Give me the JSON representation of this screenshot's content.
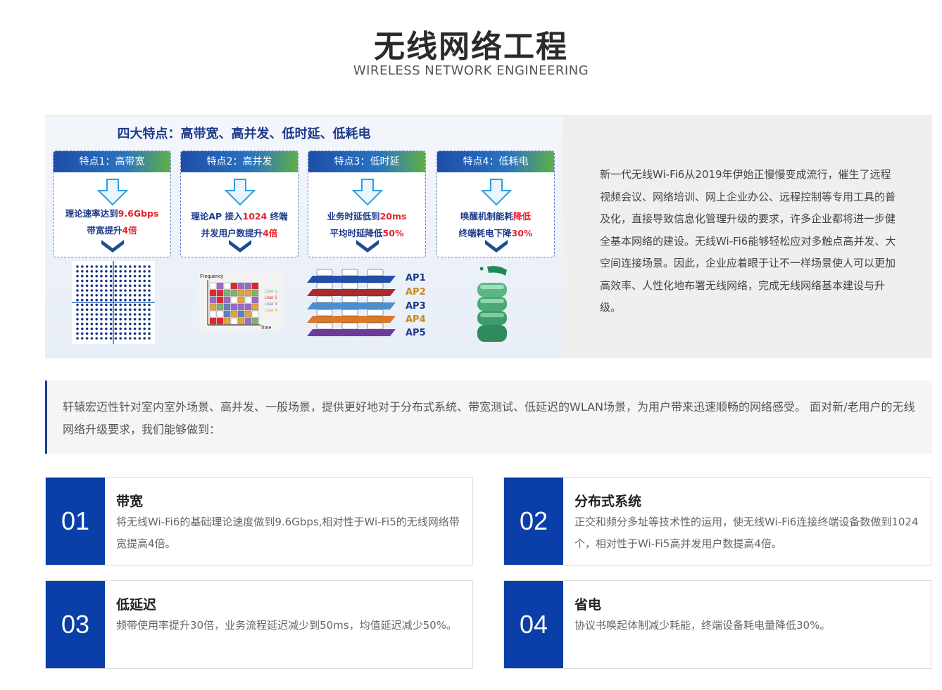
{
  "header": {
    "title": "无线网络工程",
    "subtitle": "WIRELESS NETWORK ENGINEERING"
  },
  "intro": {
    "image": {
      "heading": "四大特点：高带宽、高并发、低时延、低耗电",
      "features": [
        {
          "title": "特点1：高带宽",
          "line1_pre": "理论速率达到",
          "line1_hl": "9.6Gbps",
          "line2_pre": "带宽提升",
          "line2_hl": "4倍"
        },
        {
          "title": "特点2：高并发",
          "line1_pre": "理论AP 接入",
          "line1_hl": "1024",
          "line1_post": " 终端",
          "line2_pre": "并发用户数提升",
          "line2_hl": "4倍"
        },
        {
          "title": "特点3：低时延",
          "line1_pre": "业务时延低到",
          "line1_hl": "20ms",
          "line2_pre": "平均时延降低",
          "line2_hl": "50%"
        },
        {
          "title": "特点4：低耗电",
          "line1_pre": "唤醒机制能耗",
          "line1_hl": "降低",
          "line2_pre": "终端耗电下降",
          "line2_hl": "30%"
        }
      ],
      "freq_chart": {
        "ylabel": "Frequency",
        "xlabel": "Time",
        "legend": [
          "User 1",
          "User 2",
          "User 3",
          "User 4"
        ]
      },
      "ap_labels": [
        "AP1",
        "AP2",
        "AP3",
        "AP4",
        "AP5"
      ]
    },
    "text": "新一代无线Wi-Fi6从2019年伊始正慢慢变成流行，催生了远程视频会议、网络培训、网上企业办公、远程控制等专用工具的普及化，直接导致信息化管理升级的要求，许多企业都将进一步健全基本网络的建设。无线Wi-Fi6能够轻松应对多触点高并发、大空间连接场景。因此，企业应着眼于让不一样场景使人可以更加高效率、人性化地布署无线网络，完成无线网络基本建设与升级。"
  },
  "description": "轩辕宏迈性针对室内室外场景、高并发、一般场景，提供更好地对于分布式系统、带宽测试、低延迟的WLAN场景，为用户带来迅速顺畅的网络感受。 面对新/老用户的无线网络升级要求，我们能够做到：",
  "cards": [
    {
      "num": "01",
      "title": "带宽",
      "body": "将无线Wi-Fi6的基础理论速度做到9.6Gbps,相对性于Wi-Fi5的无线网络带宽提高4倍。"
    },
    {
      "num": "02",
      "title": "分布式系统",
      "body": "正交和频分多址等技术性的运用，使无线Wi-Fi6连接终端设备数做到1024个，相对性于Wi-Fi5高并发用户数提高4倍。"
    },
    {
      "num": "03",
      "title": "低延迟",
      "body": "频带使用率提升30倍，业务流程延迟减少到50ms，均值延迟减少50%。"
    },
    {
      "num": "04",
      "title": "省电",
      "body": "协议书唤起体制减少耗能，终端设备耗电量降低30%。"
    }
  ],
  "colors": {
    "brand_blue": "#0a3ea8",
    "accent_red": "#e8222b",
    "heading_navy": "#1d3a8a"
  }
}
